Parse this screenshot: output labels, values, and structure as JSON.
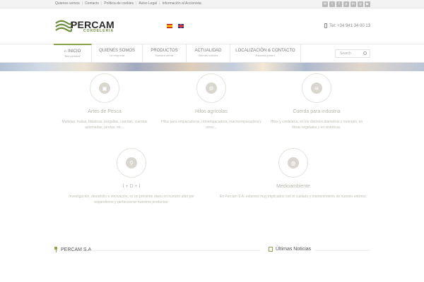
{
  "topbar": {
    "links": [
      "Quienes somos",
      "Contacto",
      "Política de cookies",
      "Aviso Legal",
      "Información al Accionista"
    ],
    "social_icons": [
      "mail-icon",
      "twitter-icon",
      "facebook-icon",
      "pinterest-icon",
      "linkedin-icon",
      "instagram-icon",
      "youtube-icon"
    ]
  },
  "header": {
    "logo_text": "PERCAM",
    "logo_sub": "CORDELERIA",
    "phone": "Tel: +34 941 34 00 13"
  },
  "nav": {
    "items": [
      {
        "title": "INICIO",
        "sub": "Bienvenidos"
      },
      {
        "title": "QUIENES SOMOS",
        "sub": "La empresa"
      },
      {
        "title": "PRODUCTOS",
        "sub": "Nuestra oferta"
      },
      {
        "title": "ACTUALIDAD",
        "sub": "Últimas noticias"
      },
      {
        "title": "LOCALIZACIÓN & CONTACTO",
        "sub": "Estamos para ti"
      }
    ],
    "search_placeholder": "Search"
  },
  "features": [
    {
      "icon": "box-icon",
      "title": "Artes de Pesca",
      "desc": "Malletas, trallas, filásticas, pargallas, cuerdas, cuerdas aplomadas, jaretas, etc..."
    },
    {
      "icon": "gears-icon",
      "title": "Hilos agrícolas",
      "desc": "Hilos para empacadoras, rotoempacadora, macroempacadora y otros..."
    },
    {
      "icon": "stack-icon",
      "title": "Cuerda para industria",
      "desc": "Hilos y cordelería, en los distintos diámetros y metrajes, en fibras vegetales y en sintéticas."
    },
    {
      "icon": "search-icon",
      "title": "I + D + I",
      "desc": "Investigación, desarrollo e innovación, es un presente diario en nuestro afán por expandirnos y perfeccionar nuestros productos."
    },
    {
      "icon": "globe-icon",
      "title": "Medioambiente",
      "desc": "En Percam S.A. estamos muy implicados con el cuidado y mantenimiento de nuestro entorno."
    }
  ],
  "bottom": {
    "left_heading": "PERCAM S.A.",
    "right_heading": "Últimas Noticias"
  }
}
